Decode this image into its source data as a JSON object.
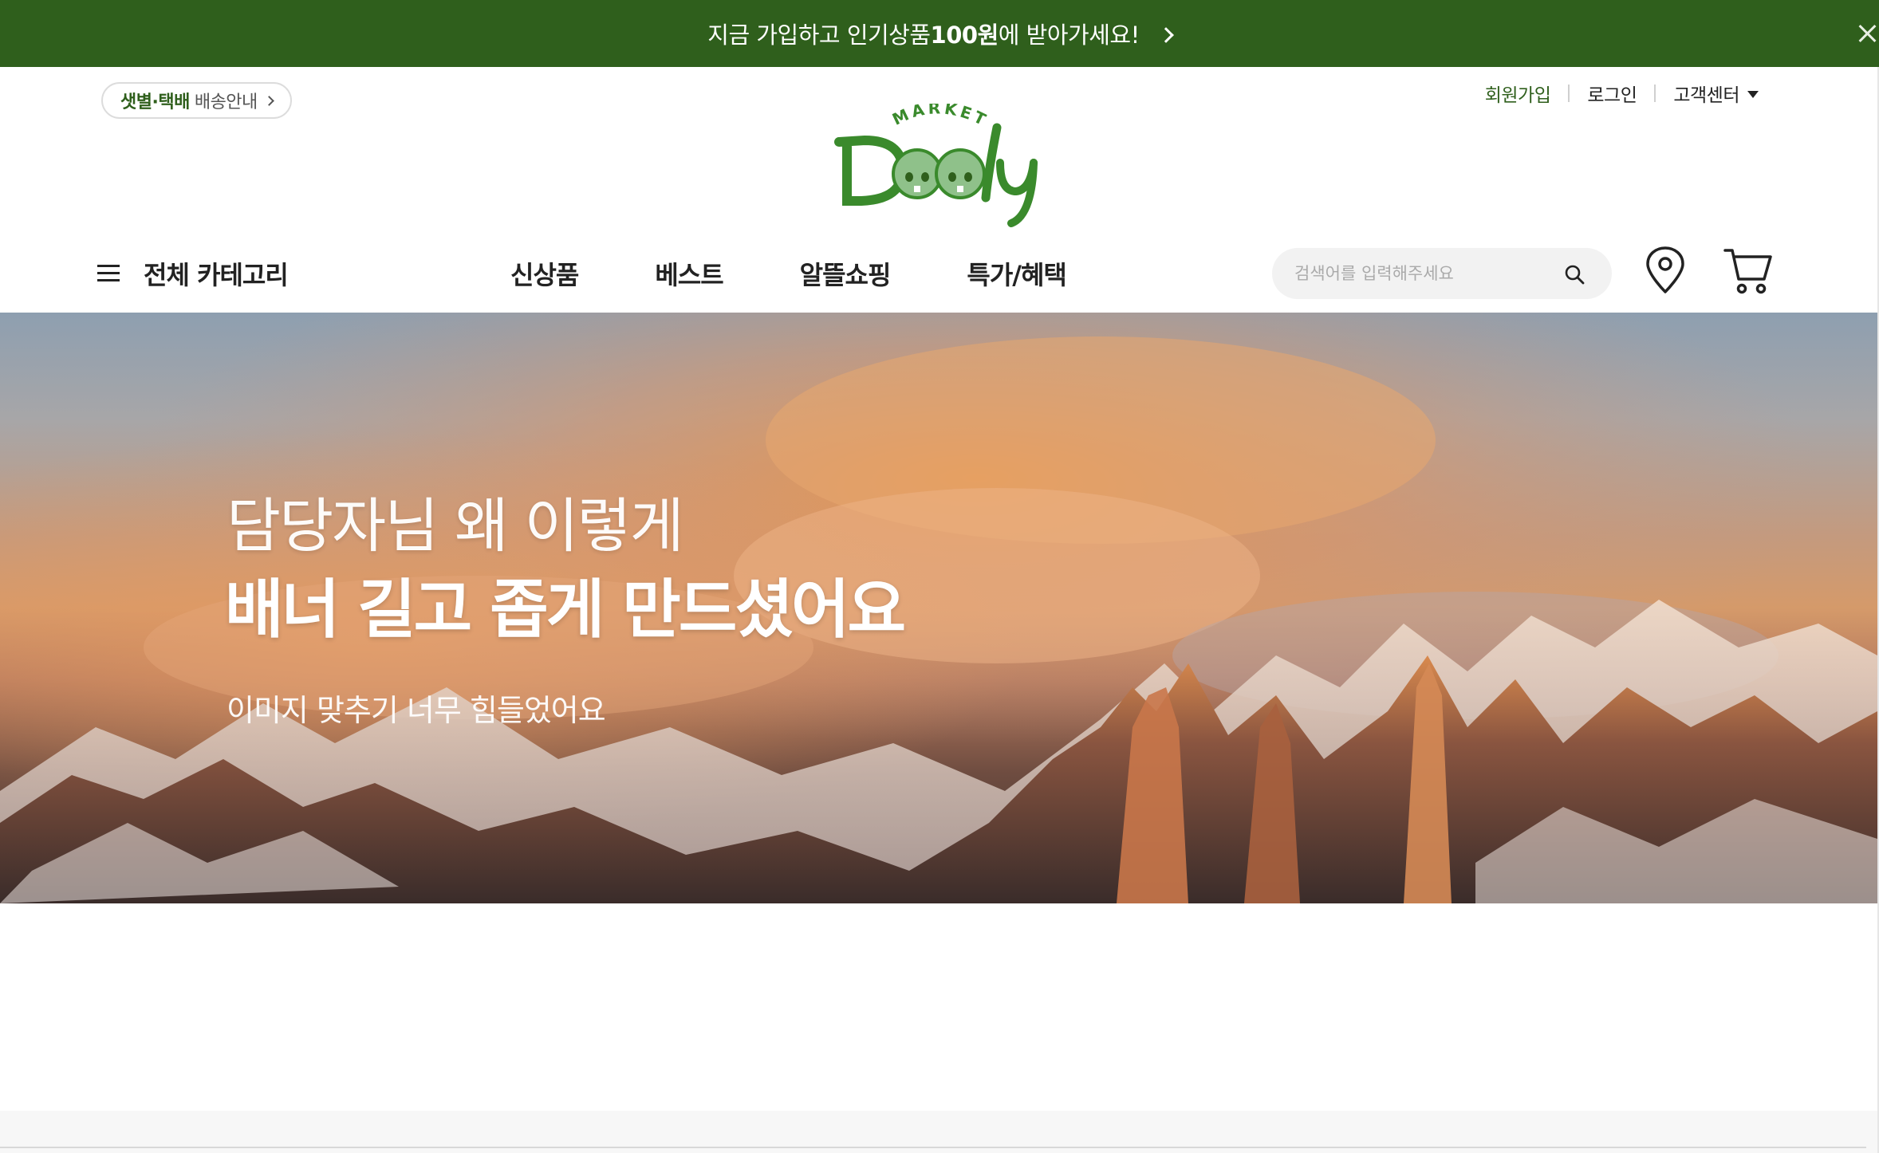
{
  "promo": {
    "text_before": "지금 가입하고 인기상품 ",
    "text_bold": "100원",
    "text_after": "에 받아가세요!"
  },
  "header": {
    "delivery_green": "샛별·택배",
    "delivery_gray": "배송안내",
    "signup": "회원가입",
    "login": "로그인",
    "customer_center": "고객센터",
    "logo_market": "MARKET",
    "logo_name": "Dooly"
  },
  "nav": {
    "all_categories": "전체 카테고리",
    "links": [
      "신상품",
      "베스트",
      "알뜰쇼핑",
      "특가/혜택"
    ]
  },
  "search": {
    "placeholder": "검색어를 입력해주세요"
  },
  "banner": {
    "line1": "담당자님 왜 이렇게",
    "line2": "배너 길고 좁게 만드셨어요",
    "sub": "이미지 맞추기 너무 힘들었어요"
  },
  "colors": {
    "brand_green": "#2f5f1c",
    "logo_green": "#3a8a2c"
  }
}
